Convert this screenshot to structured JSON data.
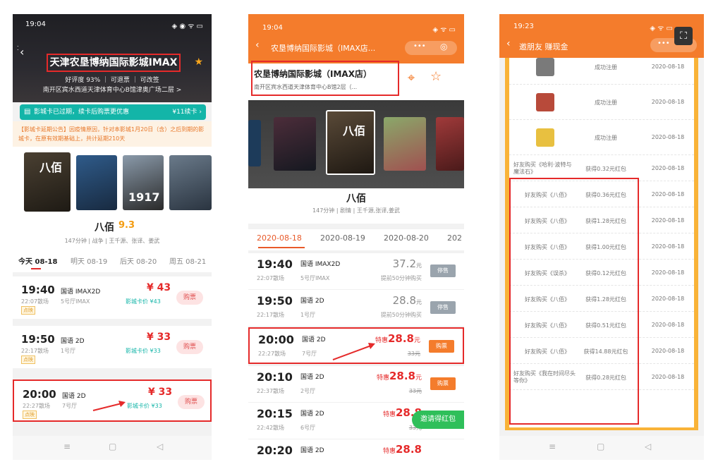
{
  "phone1": {
    "status_time": "19:04",
    "cinema_name": "天津农垦博纳国际影城IMAX",
    "rating_line": "好评度 93% ｜ 可退票 ｜ 可改签",
    "address": "南开区宾水西道天津体育中心B馆津奥广场二层 >",
    "card_bar": "影城卡已过期，续卡后购票更优惠",
    "card_bar_action": "¥11续卡 ›",
    "notice": "【影城卡延期公告】因疫情原因，针对本影城1月20日（含）之后到期的影城卡，在原有效期基础上，共计延期210天",
    "movie_title": "八佰",
    "movie_score": "9.3",
    "movie_meta": "147分钟 | 战争 | 王千源、张译、姜武",
    "date_tabs": [
      "今天 08-18",
      "明天 08-19",
      "后天 08-20",
      "周五 08-21"
    ],
    "sessions": [
      {
        "time": "19:40",
        "end": "22:07散场",
        "lang": "国语 IMAX2D",
        "hall": "5号厅IMAX",
        "price": "¥ 43",
        "card_price": "影城卡价 ¥43",
        "tag": "点映",
        "buy": "购票"
      },
      {
        "time": "19:50",
        "end": "22:17散场",
        "lang": "国语 2D",
        "hall": "1号厅",
        "price": "¥ 33",
        "card_price": "影城卡价 ¥33",
        "tag": "点映",
        "buy": "购票"
      },
      {
        "time": "20:00",
        "end": "22:27散场",
        "lang": "国语 2D",
        "hall": "7号厅",
        "price": "¥ 33",
        "card_price": "影城卡价 ¥33",
        "tag": "点映",
        "buy": "购票"
      }
    ]
  },
  "phone2": {
    "status_time": "19:04",
    "nav_title": "农垦博纳国际影城（IMAX店...",
    "cinema_name": "农垦博纳国际影城（IMAX店）",
    "address": "南开区宾水西道天津体育中心B馆2层（...",
    "movie_title": "八佰",
    "movie_meta": "147分钟 | 剧情 | 王千源,张译,姜武",
    "dates": [
      "2020-08-18",
      "2020-08-19",
      "2020-08-20",
      "202"
    ],
    "sessions": [
      {
        "time": "19:40",
        "end": "22:07散场",
        "lang": "国语 IMAX2D",
        "hall": "5号厅IMAX",
        "price": "37.2",
        "unit": "元",
        "note": "提前50分钟购买",
        "btn": "停售"
      },
      {
        "time": "19:50",
        "end": "22:17散场",
        "lang": "国语 2D",
        "hall": "1号厅",
        "price": "28.8",
        "unit": "元",
        "note": "提前50分钟购买",
        "btn": "停售"
      },
      {
        "time": "20:00",
        "end": "22:27散场",
        "lang": "国语 2D",
        "hall": "7号厅",
        "price": "28.8",
        "unit": "元",
        "prefix": "特惠",
        "old": "33元",
        "btn": "购票"
      },
      {
        "time": "20:10",
        "end": "22:37散场",
        "lang": "国语 2D",
        "hall": "2号厅",
        "price": "28.8",
        "unit": "元",
        "prefix": "特惠",
        "old": "33元",
        "btn": "购票"
      },
      {
        "time": "20:15",
        "end": "22:42散场",
        "lang": "国语 2D",
        "hall": "6号厅",
        "price": "28.8",
        "unit": "",
        "prefix": "特惠",
        "old": "33元",
        "btn": "购票"
      },
      {
        "time": "20:20",
        "end": "",
        "lang": "国语 2D",
        "hall": "",
        "price": "28.8",
        "unit": "",
        "prefix": "特惠",
        "old": "",
        "btn": ""
      }
    ],
    "invite_button": "邀请得红包"
  },
  "phone3": {
    "status_time": "19:23",
    "nav_title": "邀朋友 赚现金",
    "rows": [
      {
        "a": "",
        "b": "成功注册",
        "d": "2020-08-18"
      },
      {
        "a": "",
        "b": "成功注册",
        "d": "2020-08-18"
      },
      {
        "a": "",
        "b": "成功注册",
        "d": "2020-08-18"
      },
      {
        "a": "好友购买《哈利·波特与魔法石》",
        "b": "获得0.32元红包",
        "d": "2020-08-18"
      },
      {
        "a": "好友购买《八佰》",
        "b": "获得0.36元红包",
        "d": "2020-08-18"
      },
      {
        "a": "好友购买《八佰》",
        "b": "获得1.28元红包",
        "d": "2020-08-18"
      },
      {
        "a": "好友购买《八佰》",
        "b": "获得1.00元红包",
        "d": "2020-08-18"
      },
      {
        "a": "好友购买《误杀》",
        "b": "获得0.12元红包",
        "d": "2020-08-18"
      },
      {
        "a": "好友购买《八佰》",
        "b": "获得1.28元红包",
        "d": "2020-08-18"
      },
      {
        "a": "好友购买《八佰》",
        "b": "获得0.51元红包",
        "d": "2020-08-18"
      },
      {
        "a": "好友购买《八佰》",
        "b": "获得14.88元红包",
        "d": "2020-08-18"
      },
      {
        "a": "好友购买《我在时间尽头等你》",
        "b": "获得0.28元红包",
        "d": "2020-08-18"
      }
    ]
  },
  "colors": {
    "accent_red": "#e52a2a",
    "orange": "#f47c2c",
    "teal": "#13b5a8"
  }
}
